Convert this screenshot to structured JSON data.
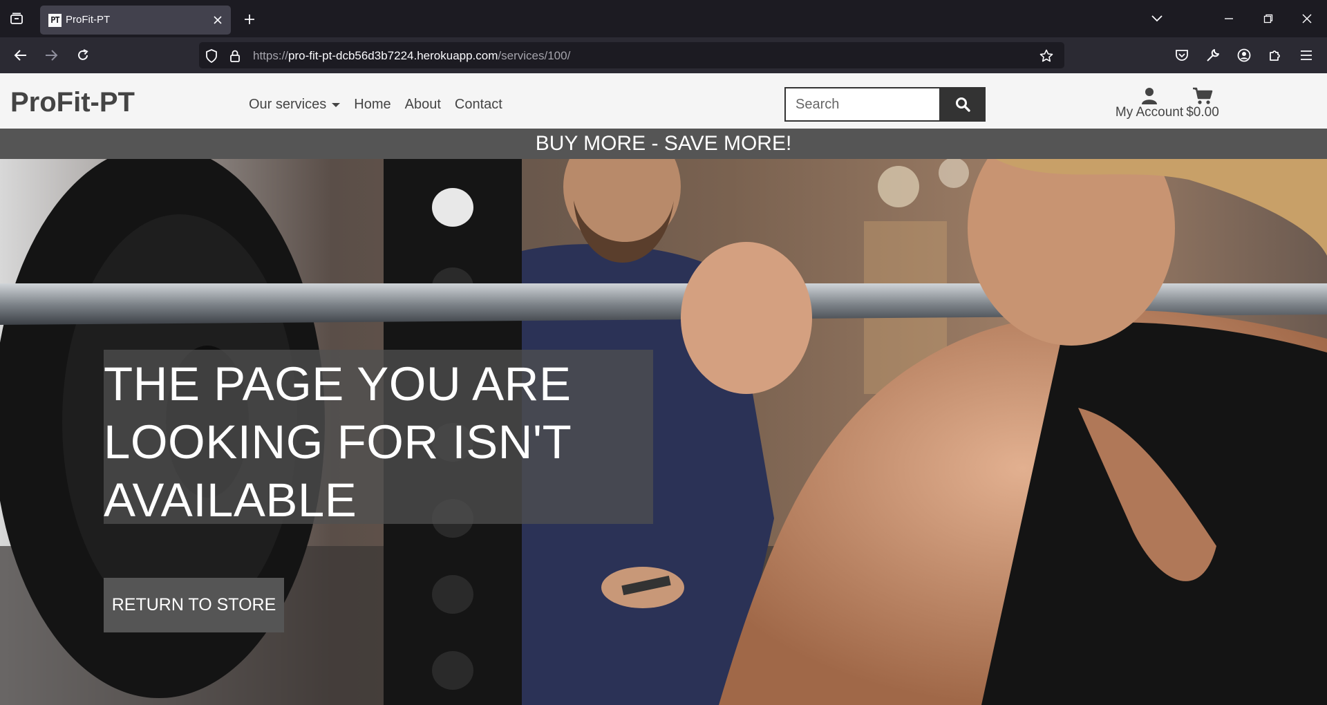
{
  "browser": {
    "tab": {
      "favicon_text": "PT",
      "title": "ProFit-PT"
    },
    "url": {
      "host_prefix": "https://",
      "host": "pro-fit-pt-dcb56d3b7224.herokuapp.com",
      "path": "/services/100/"
    },
    "colors": {
      "chrome_bg": "#1c1b22",
      "toolbar_bg": "#2b2a33",
      "active_tab_bg": "#42414d"
    }
  },
  "site": {
    "brand": "ProFit-PT",
    "nav": {
      "services_label": "Our services",
      "home_label": "Home",
      "about_label": "About",
      "contact_label": "Contact"
    },
    "search": {
      "placeholder": "Search"
    },
    "account": {
      "label": "My Account",
      "icon": "user-icon"
    },
    "cart": {
      "total": "$0.00",
      "icon": "cart-icon"
    },
    "promo": "BUY MORE - SAVE MORE!",
    "hero": {
      "title": "THE PAGE YOU ARE LOOKING FOR ISN'T AVAILABLE",
      "button_label": "RETURN TO STORE"
    },
    "colors": {
      "header_bg": "#f5f5f5",
      "promo_bg": "#555555",
      "accent_dark": "#333333"
    }
  }
}
